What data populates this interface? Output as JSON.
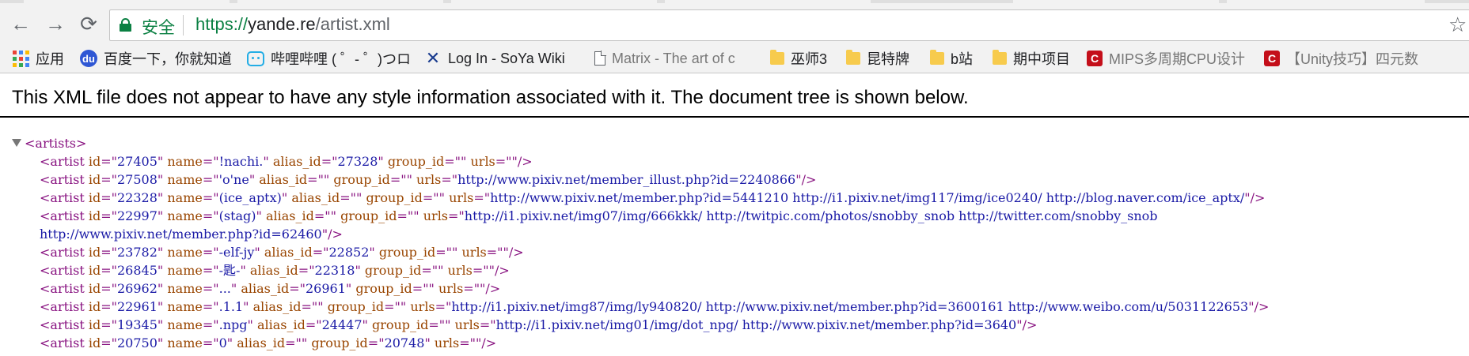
{
  "browser": {
    "nav": {
      "back_icon": "←",
      "forward_icon": "→",
      "reload_icon": "⟳"
    },
    "address": {
      "security_label": "安全",
      "url_scheme": "https://",
      "url_host": "yande.re",
      "url_path": "/artist.xml"
    },
    "star_icon": "☆"
  },
  "bookmarks": [
    {
      "label": "应用",
      "icon": "apps-icon"
    },
    {
      "label": "百度一下，你就知道",
      "icon": "baidu-icon"
    },
    {
      "label": "哔哩哔哩 ( ゜- ゜)つロ",
      "icon": "bilibili-icon"
    },
    {
      "label": "Log In - SoYa Wiki",
      "icon": "soya-icon"
    },
    {
      "label": "Matrix - The art of c",
      "icon": "page-icon"
    },
    {
      "label": "巫师3",
      "icon": "folder-icon"
    },
    {
      "label": "昆特牌",
      "icon": "folder-icon"
    },
    {
      "label": "b站",
      "icon": "folder-icon"
    },
    {
      "label": "期中项目",
      "icon": "folder-icon"
    },
    {
      "label": "MIPS多周期CPU设计",
      "icon": "csdn-icon"
    },
    {
      "label": "【Unity技巧】四元数",
      "icon": "csdn-icon"
    }
  ],
  "notice": "This XML file does not appear to have any style information associated with it. The document tree is shown below.",
  "xml": {
    "root_tag": "artists",
    "artists": [
      {
        "id": "27405",
        "name": "!nachi.",
        "alias_id": "27328",
        "group_id": "",
        "urls": ""
      },
      {
        "id": "27508",
        "name": "'o'ne",
        "alias_id": "",
        "group_id": "",
        "urls": "http://www.pixiv.net/member_illust.php?id=2240866"
      },
      {
        "id": "22328",
        "name": "(ice_aptx)",
        "alias_id": "",
        "group_id": "",
        "urls": "http://www.pixiv.net/member.php?id=5441210 http://i1.pixiv.net/img117/img/ice0240/ http://blog.naver.com/ice_aptx/"
      },
      {
        "id": "22997",
        "name": "(stag)",
        "alias_id": "",
        "group_id": "",
        "urls": "http://i1.pixiv.net/img07/img/666kkk/ http://twitpic.com/photos/snobby_snob http://twitter.com/snobby_snob",
        "urls_cont": "http://www.pixiv.net/member.php?id=62460"
      },
      {
        "id": "23782",
        "name": "-elf-jy",
        "alias_id": "22852",
        "group_id": "",
        "urls": ""
      },
      {
        "id": "26845",
        "name": "-匙-",
        "alias_id": "22318",
        "group_id": "",
        "urls": ""
      },
      {
        "id": "26962",
        "name": "...",
        "alias_id": "26961",
        "group_id": "",
        "urls": ""
      },
      {
        "id": "22961",
        "name": ".1.1",
        "alias_id": "",
        "group_id": "",
        "urls": "http://i1.pixiv.net/img87/img/ly940820/ http://www.pixiv.net/member.php?id=3600161 http://www.weibo.com/u/5031122653"
      },
      {
        "id": "19345",
        "name": ".npg",
        "alias_id": "24447",
        "group_id": "",
        "urls": "http://i1.pixiv.net/img01/img/dot_npg/ http://www.pixiv.net/member.php?id=3640"
      },
      {
        "id": "20750",
        "name": "0",
        "alias_id": "",
        "group_id": "20748",
        "urls": ""
      }
    ]
  }
}
